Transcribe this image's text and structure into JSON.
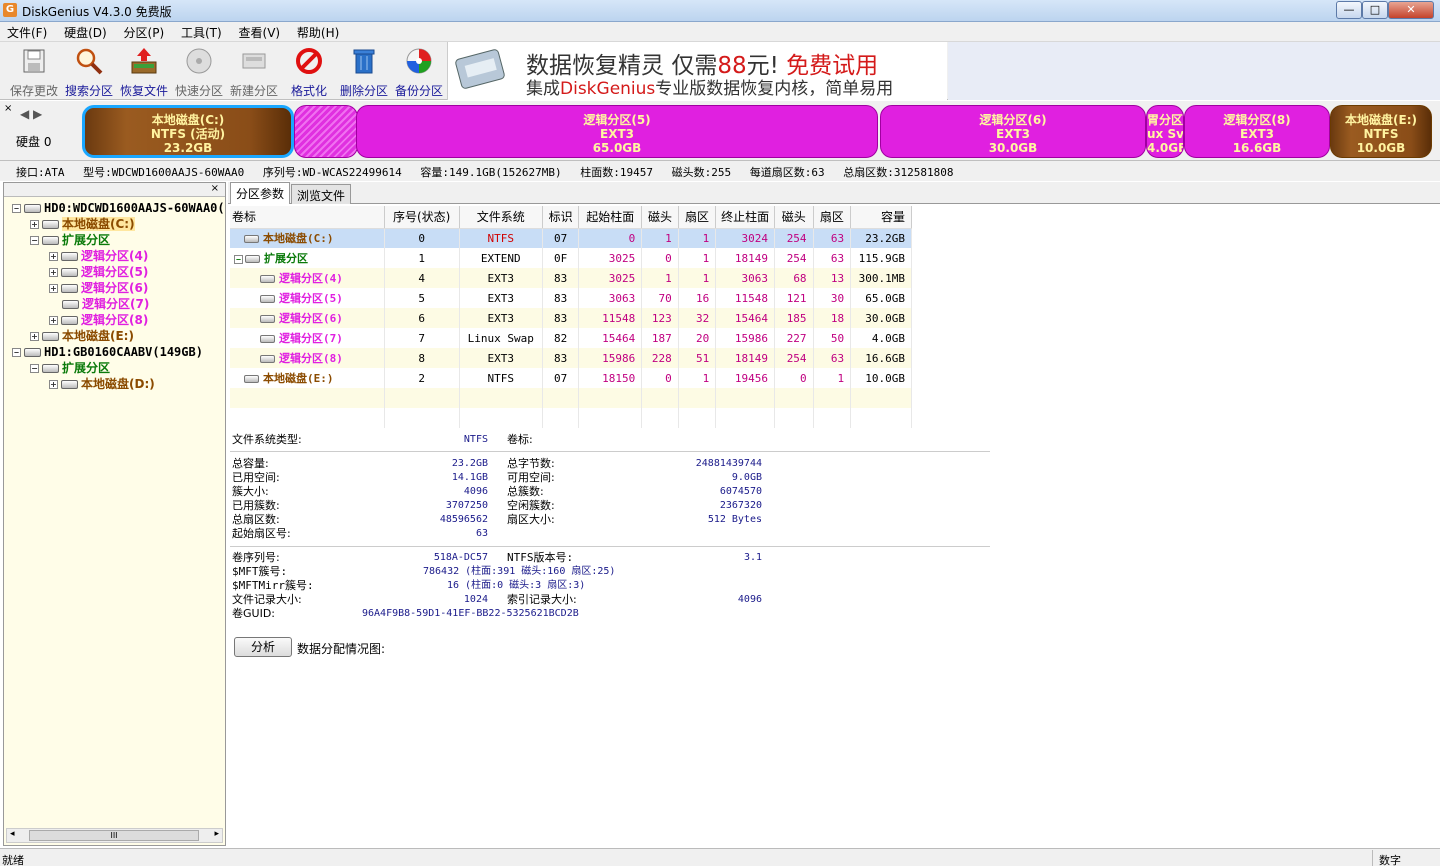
{
  "window": {
    "title": "DiskGenius V4.3.0 免费版",
    "icon": "G",
    "controls": {
      "min": "—",
      "max": "□",
      "close": "✕"
    }
  },
  "menu": [
    "文件(F)",
    "硬盘(D)",
    "分区(P)",
    "工具(T)",
    "查看(V)",
    "帮助(H)"
  ],
  "toolbar": [
    {
      "label": "保存更改",
      "icon": "save-icon",
      "enabled": false
    },
    {
      "label": "搜索分区",
      "icon": "search-partition-icon",
      "enabled": true
    },
    {
      "label": "恢复文件",
      "icon": "recover-file-icon",
      "enabled": true
    },
    {
      "label": "快速分区",
      "icon": "quick-partition-icon",
      "enabled": false
    },
    {
      "label": "新建分区",
      "icon": "new-partition-icon",
      "enabled": false
    },
    {
      "label": "格式化",
      "icon": "format-icon",
      "enabled": true
    },
    {
      "label": "删除分区",
      "icon": "delete-partition-icon",
      "enabled": true
    },
    {
      "label": "备份分区",
      "icon": "backup-partition-icon",
      "enabled": true
    }
  ],
  "ad": {
    "line1_a": "数据恢复精灵",
    "line1_b": "仅需",
    "line1_c": "88",
    "line1_d": "元!",
    "line1_e": "免费试用",
    "line2_a": "集成",
    "line2_b": "DiskGenius",
    "line2_c": "专业版数据恢复内核，简单易用"
  },
  "diskmap": {
    "disk_label": "硬盘 0",
    "segments": [
      {
        "name": "本地磁盘(C:)",
        "fs": "NTFS (活动)",
        "size": "23.2GB",
        "kind": "primary",
        "active": true
      },
      {
        "name": "逻辑分区(5)",
        "fs": "EXT3",
        "size": "65.0GB",
        "kind": "logical"
      },
      {
        "name": "逻辑分区(6)",
        "fs": "EXT3",
        "size": "30.0GB",
        "kind": "logical"
      },
      {
        "name": "胃分区",
        "fs": "ux Sv",
        "size": "4.0GE",
        "kind": "logical"
      },
      {
        "name": "逻辑分区(8)",
        "fs": "EXT3",
        "size": "16.6GB",
        "kind": "logical"
      },
      {
        "name": "本地磁盘(E:)",
        "fs": "NTFS",
        "size": "10.0GB",
        "kind": "primary"
      }
    ]
  },
  "diskinfo": {
    "interface": "接口:ATA",
    "model": "型号:WDCWD1600AAJS-60WAA0",
    "serial": "序列号:WD-WCAS22499614",
    "capacity": "容量:149.1GB(152627MB)",
    "cylinders": "柱面数:19457",
    "heads": "磁头数:255",
    "sectors_per_track": "每道扇区数:63",
    "total_sectors": "总扇区数:312581808"
  },
  "tree": {
    "close": "×",
    "nodes": [
      {
        "label": "HD0:WDCWD1600AAJS-60WAA0(",
        "kind": "disk",
        "exp": "−"
      },
      {
        "label": "本地磁盘(C:)",
        "kind": "primary",
        "exp": "+",
        "sel": true
      },
      {
        "label": "扩展分区",
        "kind": "extend",
        "exp": "−"
      },
      {
        "label": "逻辑分区(4)",
        "kind": "logical",
        "exp": "+"
      },
      {
        "label": "逻辑分区(5)",
        "kind": "logical",
        "exp": "+"
      },
      {
        "label": "逻辑分区(6)",
        "kind": "logical",
        "exp": "+"
      },
      {
        "label": "逻辑分区(7)",
        "kind": "logical",
        "exp": ""
      },
      {
        "label": "逻辑分区(8)",
        "kind": "logical",
        "exp": "+"
      },
      {
        "label": "本地磁盘(E:)",
        "kind": "primary",
        "exp": "+"
      },
      {
        "label": "HD1:GB0160CAABV(149GB)",
        "kind": "disk",
        "exp": "−"
      },
      {
        "label": "扩展分区",
        "kind": "extend",
        "exp": "−"
      },
      {
        "label": "本地磁盘(D:)",
        "kind": "primary",
        "exp": "+"
      }
    ],
    "scroll_thumb": "III"
  },
  "tabs": [
    "分区参数",
    "浏览文件"
  ],
  "table": {
    "headers": [
      "卷标",
      "序号(状态)",
      "文件系统",
      "标识",
      "起始柱面",
      "磁头",
      "扇区",
      "终止柱面",
      "磁头",
      "扇区",
      "容量"
    ],
    "rows": [
      [
        "本地磁盘(C:)",
        "0",
        "NTFS",
        "07",
        "0",
        "1",
        "1",
        "3024",
        "254",
        "63",
        "23.2GB"
      ],
      [
        "扩展分区",
        "1",
        "EXTEND",
        "0F",
        "3025",
        "0",
        "1",
        "18149",
        "254",
        "63",
        "115.9GB"
      ],
      [
        "逻辑分区(4)",
        "4",
        "EXT3",
        "83",
        "3025",
        "1",
        "1",
        "3063",
        "68",
        "13",
        "300.1MB"
      ],
      [
        "逻辑分区(5)",
        "5",
        "EXT3",
        "83",
        "3063",
        "70",
        "16",
        "11548",
        "121",
        "30",
        "65.0GB"
      ],
      [
        "逻辑分区(6)",
        "6",
        "EXT3",
        "83",
        "11548",
        "123",
        "32",
        "15464",
        "185",
        "18",
        "30.0GB"
      ],
      [
        "逻辑分区(7)",
        "7",
        "Linux Swap",
        "82",
        "15464",
        "187",
        "20",
        "15986",
        "227",
        "50",
        "4.0GB"
      ],
      [
        "逻辑分区(8)",
        "8",
        "EXT3",
        "83",
        "15986",
        "228",
        "51",
        "18149",
        "254",
        "63",
        "16.6GB"
      ],
      [
        "本地磁盘(E:)",
        "2",
        "NTFS",
        "07",
        "18150",
        "0",
        "1",
        "19456",
        "0",
        "1",
        "10.0GB"
      ]
    ]
  },
  "fs": {
    "fstype_label": "文件系统类型:",
    "fstype": "NTFS",
    "vol_label": "卷标:",
    "total_cap_label": "总容量:",
    "total_cap": "23.2GB",
    "used_label": "已用空间:",
    "used": "14.1GB",
    "cluster_label": "簇大小:",
    "cluster": "4096",
    "used_clusters_label": "已用簇数:",
    "used_clusters": "3707250",
    "total_sectors_label": "总扇区数:",
    "total_sectors": "48596562",
    "start_sector_label": "起始扇区号:",
    "start_sector": "63",
    "total_bytes_label": "总字节数:",
    "total_bytes": "24881439744",
    "free_label": "可用空间:",
    "free": "9.0GB",
    "total_clusters_label": "总簇数:",
    "total_clusters": "6074570",
    "free_clusters_label": "空闲簇数:",
    "free_clusters": "2367320",
    "sector_size_label": "扇区大小:",
    "sector_size": "512 Bytes",
    "serial_label": "卷序列号:",
    "serial": "518A-DC57",
    "ntfs_ver_label": "NTFS版本号:",
    "ntfs_ver": "3.1",
    "mft_label": "$MFT簇号:",
    "mft": "786432 (柱面:391 磁头:160 扇区:25)",
    "mftmirr_label": "$MFTMirr簇号:",
    "mftmirr": "16 (柱面:0 磁头:3 扇区:3)",
    "record_label": "文件记录大小:",
    "record": "1024",
    "index_label": "索引记录大小:",
    "index": "4096",
    "guid_label": "卷GUID:",
    "guid": "96A4F9B8-59D1-41EF-BB22-5325621BCD2B"
  },
  "analyze_button": "分析",
  "alloc_label": "数据分配情况图:",
  "status": {
    "left": "就绪",
    "right": "数字"
  },
  "colors": {
    "primary": "#8b4b00",
    "extend": "#0a7a0a",
    "logical": "#e020e0",
    "selection": "#c8ddf6"
  }
}
